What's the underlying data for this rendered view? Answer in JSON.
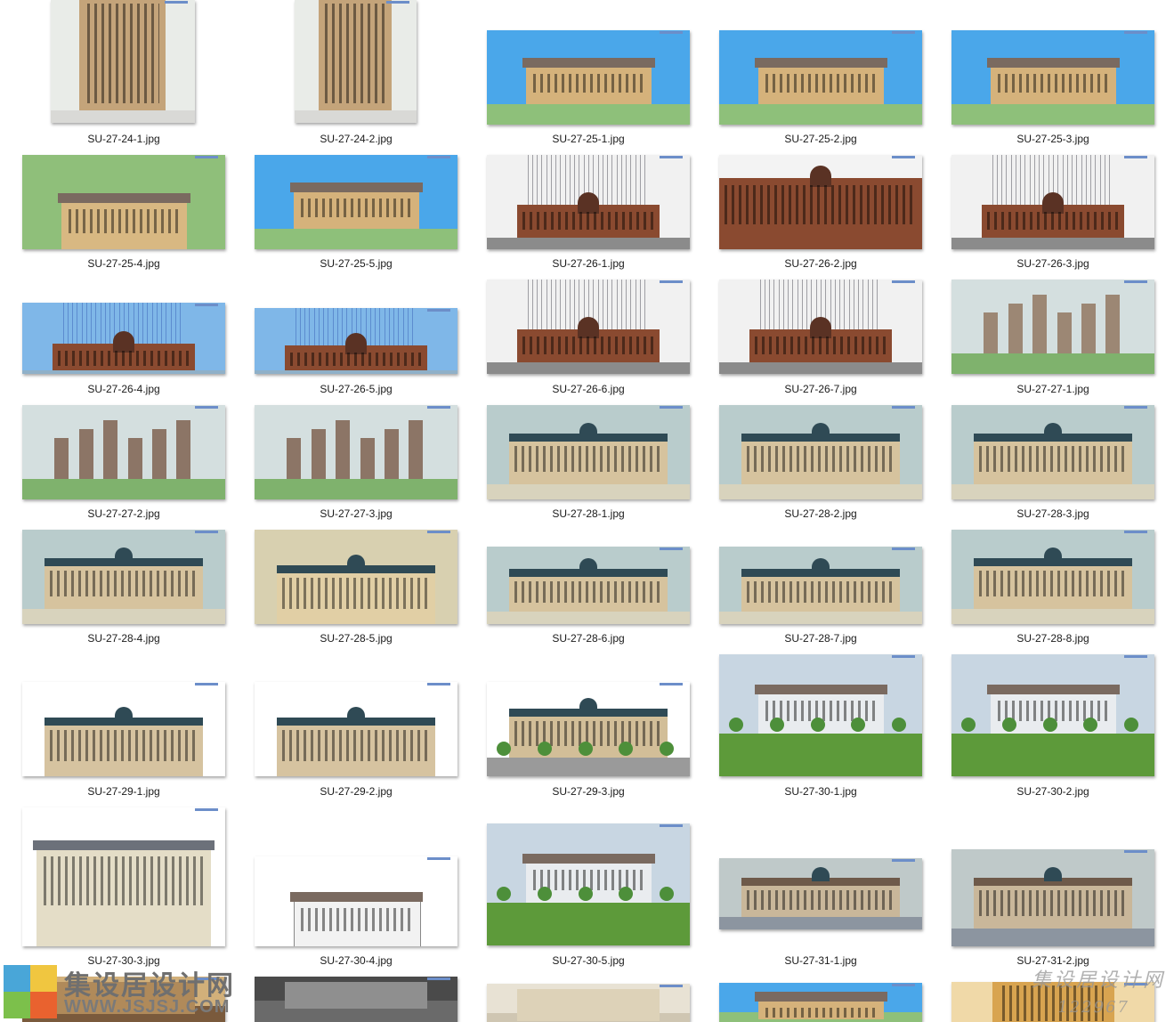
{
  "files": [
    {
      "name": "SU-27-24-1.jpg",
      "style": "tower-skybox"
    },
    {
      "name": "SU-27-24-2.jpg",
      "style": "tower-skybox"
    },
    {
      "name": "SU-27-25-1.jpg",
      "style": "villa-blue"
    },
    {
      "name": "SU-27-25-2.jpg",
      "style": "villa-blue"
    },
    {
      "name": "SU-27-25-3.jpg",
      "style": "villa-blue"
    },
    {
      "name": "SU-27-25-4.jpg",
      "style": "villa-aerial"
    },
    {
      "name": "SU-27-25-5.jpg",
      "style": "villa-blue"
    },
    {
      "name": "SU-27-26-1.jpg",
      "style": "brick-street"
    },
    {
      "name": "SU-27-26-2.jpg",
      "style": "brick-close"
    },
    {
      "name": "SU-27-26-3.jpg",
      "style": "brick-street"
    },
    {
      "name": "SU-27-26-4.jpg",
      "style": "brick-lines"
    },
    {
      "name": "SU-27-26-5.jpg",
      "style": "brick-lines"
    },
    {
      "name": "SU-27-26-6.jpg",
      "style": "brick-street"
    },
    {
      "name": "SU-27-26-7.jpg",
      "style": "brick-street"
    },
    {
      "name": "SU-27-27-1.jpg",
      "style": "towers-far"
    },
    {
      "name": "SU-27-27-2.jpg",
      "style": "towers-row"
    },
    {
      "name": "SU-27-27-3.jpg",
      "style": "towers-row"
    },
    {
      "name": "SU-27-28-1.jpg",
      "style": "classic-gray"
    },
    {
      "name": "SU-27-28-2.jpg",
      "style": "classic-gray"
    },
    {
      "name": "SU-27-28-3.jpg",
      "style": "classic-gray"
    },
    {
      "name": "SU-27-28-4.jpg",
      "style": "classic-gray"
    },
    {
      "name": "SU-27-28-5.jpg",
      "style": "classic-beige"
    },
    {
      "name": "SU-27-28-6.jpg",
      "style": "classic-gray"
    },
    {
      "name": "SU-27-28-7.jpg",
      "style": "classic-gray"
    },
    {
      "name": "SU-27-28-8.jpg",
      "style": "classic-gray"
    },
    {
      "name": "SU-27-29-1.jpg",
      "style": "white-sketch"
    },
    {
      "name": "SU-27-29-2.jpg",
      "style": "white-sketch"
    },
    {
      "name": "SU-27-29-3.jpg",
      "style": "white-street"
    },
    {
      "name": "SU-27-30-1.jpg",
      "style": "render-park"
    },
    {
      "name": "SU-27-30-2.jpg",
      "style": "render-park"
    },
    {
      "name": "SU-27-30-3.jpg",
      "style": "render-villa"
    },
    {
      "name": "SU-27-30-4.jpg",
      "style": "white-line"
    },
    {
      "name": "SU-27-30-5.jpg",
      "style": "render-park"
    },
    {
      "name": "SU-27-31-1.jpg",
      "style": "town-gray"
    },
    {
      "name": "SU-27-31-2.jpg",
      "style": "town-gray"
    },
    {
      "name": "",
      "style": "interior-warm"
    },
    {
      "name": "",
      "style": "interior-dark"
    },
    {
      "name": "",
      "style": "interior-hall"
    },
    {
      "name": "",
      "style": "villa-blue"
    },
    {
      "name": "",
      "style": "tower-warm"
    }
  ],
  "colors": {
    "sky_blue": "#4aa7ea",
    "grass": "#7fb26d",
    "gray_sky": "#b9c9c9",
    "beige": "#d8c29a",
    "brick": "#8a4a30",
    "thumb_tag": "#6c8ec9"
  },
  "logo": {
    "cn": "集设居设计网",
    "url": "WWW.JSJSJ.COM"
  },
  "watermark": {
    "cn": "集设居设计网",
    "number": "122967"
  }
}
